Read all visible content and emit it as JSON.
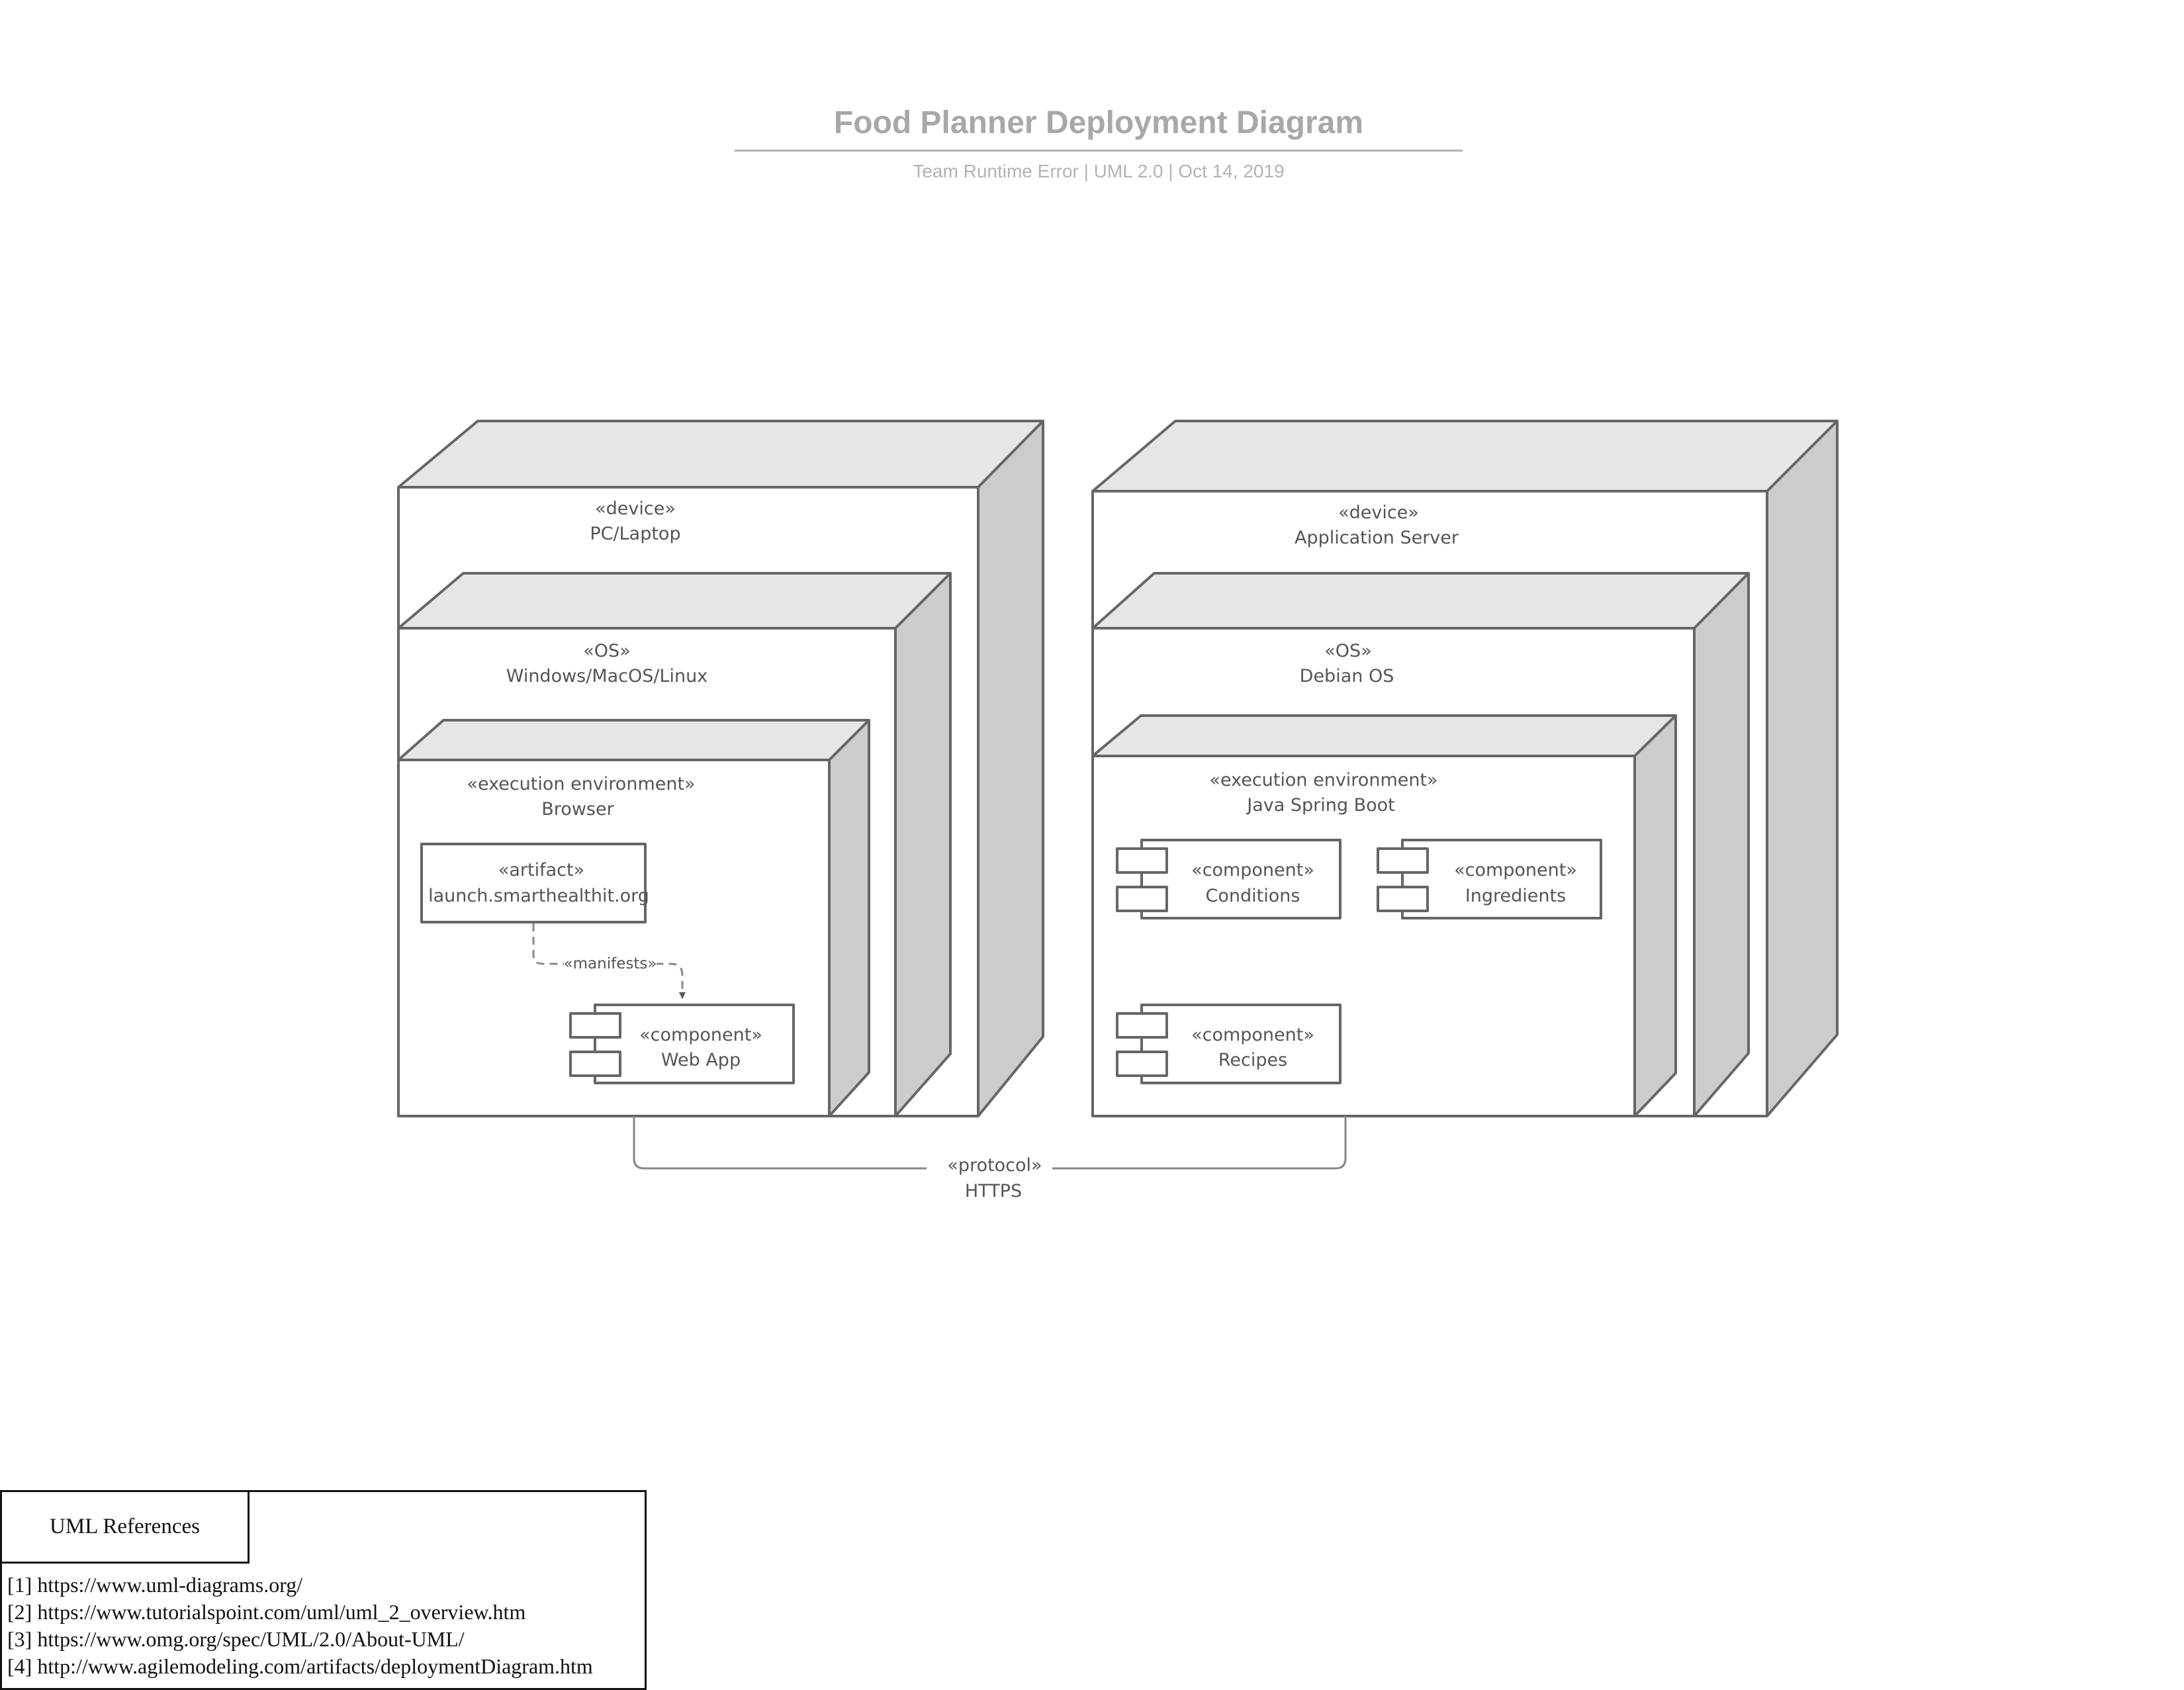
{
  "header": {
    "title": "Food Planner Deployment Diagram",
    "subtitle": "Team Runtime Error | UML 2.0 | Oct 14, 2019"
  },
  "client": {
    "device": {
      "stereotype": "«device»",
      "name": "PC/Laptop"
    },
    "os": {
      "stereotype": "«OS»",
      "name": "Windows/MacOS/Linux"
    },
    "env": {
      "stereotype": "«execution environment»",
      "name": "Browser"
    },
    "artifact": {
      "stereotype": "«artifact»",
      "name": "launch.smarthealthit.org"
    },
    "manifests": "«manifests»",
    "webapp": {
      "stereotype": "«component»",
      "name": "Web App"
    }
  },
  "server": {
    "device": {
      "stereotype": "«device»",
      "name": "Application Server"
    },
    "os": {
      "stereotype": "«OS»",
      "name": "Debian OS"
    },
    "env": {
      "stereotype": "«execution environment»",
      "name": "Java Spring Boot"
    },
    "conditions": {
      "stereotype": "«component»",
      "name": "Conditions"
    },
    "ingredients": {
      "stereotype": "«component»",
      "name": "Ingredients"
    },
    "recipes": {
      "stereotype": "«component»",
      "name": "Recipes"
    }
  },
  "link": {
    "stereotype": "«protocol»",
    "name": "HTTPS"
  },
  "references": {
    "title": "UML References",
    "items": [
      "[1] https://www.uml-diagrams.org/",
      "[2] https://www.tutorialspoint.com/uml/uml_2_overview.htm",
      "[3] https://www.omg.org/spec/UML/2.0/About-UML/",
      "[4] http://www.agilemodeling.com/artifacts/deploymentDiagram.htm"
    ]
  }
}
